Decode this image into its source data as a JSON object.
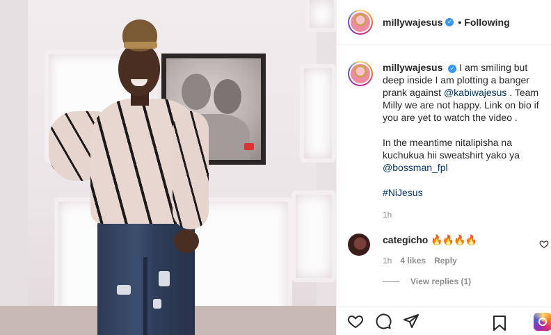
{
  "post": {
    "author": "millywajesus",
    "verified_icon": "verified-badge-icon",
    "separator": "•",
    "follow_status": "Following"
  },
  "caption": {
    "author": "millywajesus",
    "text_part1": "I am smiling but deep inside I am plotting a banger prank against",
    "mention1": "@kabiwajesus",
    "text_part2": ". Team Milly we are not happy. Link on bio if you are yet to watch the video .",
    "text_part3": "In the meantime nitalipisha na kuchukua hii sweatshirt yako ya",
    "mention2": "@bossman_fpl",
    "hashtag": "#NiJesus",
    "time": "1h"
  },
  "comments": [
    {
      "author": "categicho",
      "text": "🔥🔥🔥🔥",
      "time": "1h",
      "likes": "4 likes",
      "reply_label": "Reply",
      "view_replies": "View replies (1)"
    }
  ],
  "actions": {
    "like_icon": "heart-icon",
    "comment_icon": "comment-icon",
    "share_icon": "paper-plane-icon",
    "save_icon": "bookmark-icon"
  },
  "colors": {
    "link": "#00376b",
    "verified": "#3897f0",
    "muted": "#8e8e8e",
    "text": "#262626"
  }
}
